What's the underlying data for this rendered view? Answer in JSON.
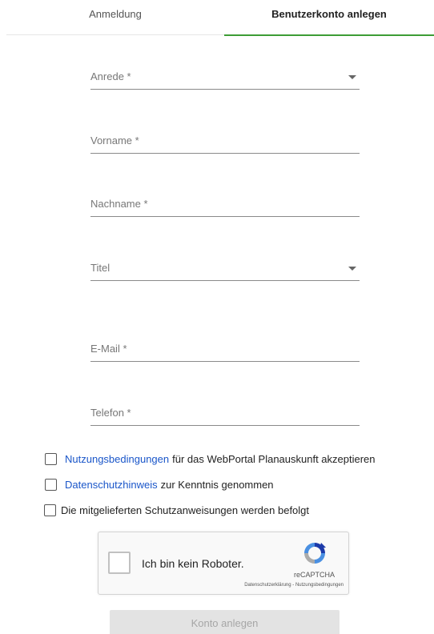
{
  "tabs": {
    "login": "Anmeldung",
    "register": "Benutzerkonto anlegen"
  },
  "fields": {
    "salutation": "Anrede *",
    "firstname": "Vorname *",
    "lastname": "Nachname *",
    "title": "Titel",
    "email": "E-Mail *",
    "phone": "Telefon *"
  },
  "checks": {
    "terms_link": "Nutzungsbedingungen",
    "terms_rest": "für das WebPortal Planauskunft akzeptieren",
    "privacy_link": "Datenschutzhinweis",
    "privacy_rest": "zur Kenntnis genommen",
    "protection": "Die mitgelieferten Schutzanweisungen werden befolgt"
  },
  "captcha": {
    "label": "Ich bin kein Roboter.",
    "brand": "reCAPTCHA",
    "privacy": "Datenschutzerklärung",
    "separator": " - ",
    "terms": "Nutzungsbedingungen"
  },
  "submit_label": "Konto anlegen",
  "colors": {
    "accent": "#3d9c35",
    "link": "#1a56c9"
  }
}
